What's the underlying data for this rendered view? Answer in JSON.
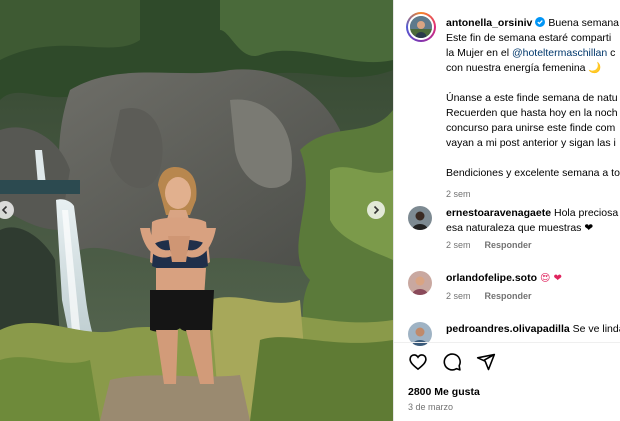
{
  "post": {
    "author": "antonella_orsiniv",
    "caption_lines": [
      "Buena semana t",
      "Este fin de semana estaré comparti",
      "la Mujer en el ",
      "con nuestra energía femenina 🌙",
      "Únanse a este finde semana de natu",
      "Recuerden que hasta hoy en la noch",
      "concurso para unirse este finde com",
      "vayan a mi post anterior y sigan las i",
      "Bendiciones y excelente semana a to"
    ],
    "mention": "@hoteltermaschillan",
    "mention_suffix": " c",
    "time": "2 sem"
  },
  "comments": [
    {
      "user": "ernestoaravenagaete",
      "text": "Hola preciosa",
      "text2": "esa naturaleza que muestras ❤",
      "time": "2 sem",
      "reply": "Responder"
    },
    {
      "user": "orlandofelipe.soto",
      "text": "😍 ❤",
      "time": "2 sem",
      "reply": "Responder"
    },
    {
      "user": "pedroandres.olivapadilla",
      "text": "Se ve linda"
    }
  ],
  "stats": {
    "likes": "2800 Me gusta",
    "date": "3 de marzo"
  },
  "icons": [
    "heart-icon",
    "comment-icon",
    "share-icon",
    "verified-badge-icon",
    "chevron-left-icon",
    "chevron-right-icon"
  ],
  "colors": {
    "verified": "#0095f6",
    "link": "#00376b",
    "meta": "#737373"
  }
}
